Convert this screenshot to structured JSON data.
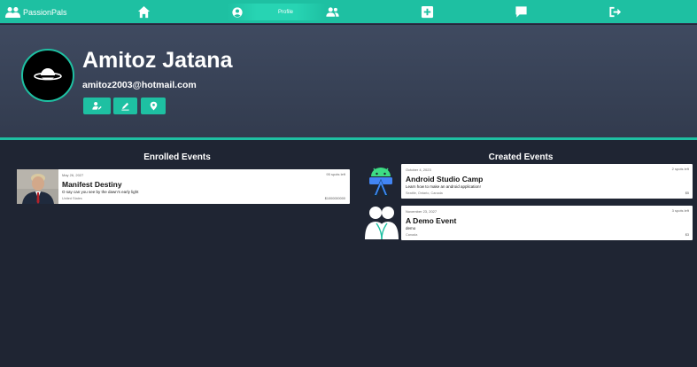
{
  "nav": {
    "brand": "PassionPals",
    "profile_label": "Profile",
    "icons": [
      "home-icon",
      "user-circle-icon",
      "friends-icon",
      "add-square-icon",
      "chat-icon",
      "logout-icon"
    ]
  },
  "profile": {
    "name": "Amitoz Jatana",
    "email": "amitoz2003@hotmail.com",
    "buttons": [
      "edit-profile-icon",
      "pencil-icon",
      "location-pin-icon"
    ]
  },
  "enrolled": {
    "title": "Enrolled Events",
    "events": [
      {
        "date": "May 26, 2027",
        "spots": "95 spots left",
        "title": "Manifest Destiny",
        "description": "O say can you see by the dawn's early light",
        "location": "United States",
        "price": "$1000000000"
      }
    ]
  },
  "created": {
    "title": "Created Events",
    "events": [
      {
        "date": "October 4, 2023",
        "spots": "2 spots left",
        "title": "Android Studio Camp",
        "description": "Learn how to make an android application!",
        "location": "Seattle, Ontario, Canada",
        "price": "$5"
      },
      {
        "date": "November 23, 2027",
        "spots": "3 spots left",
        "title": "A Demo Event",
        "description": "demo",
        "location": "Canada",
        "price": "$3"
      }
    ]
  },
  "colors": {
    "accent": "#1ec0a2",
    "background": "#1f2533",
    "header": "#3a4459"
  }
}
